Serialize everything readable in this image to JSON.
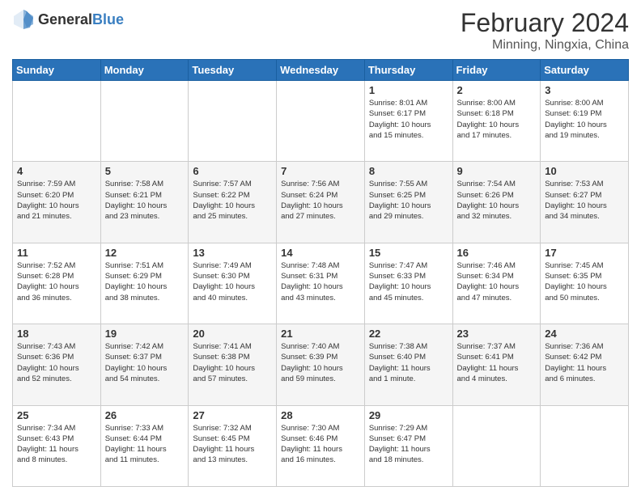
{
  "header": {
    "logo_general": "General",
    "logo_blue": "Blue",
    "title": "February 2024",
    "subtitle": "Minning, Ningxia, China"
  },
  "weekdays": [
    "Sunday",
    "Monday",
    "Tuesday",
    "Wednesday",
    "Thursday",
    "Friday",
    "Saturday"
  ],
  "weeks": [
    [
      {
        "day": "",
        "info": ""
      },
      {
        "day": "",
        "info": ""
      },
      {
        "day": "",
        "info": ""
      },
      {
        "day": "",
        "info": ""
      },
      {
        "day": "1",
        "info": "Sunrise: 8:01 AM\nSunset: 6:17 PM\nDaylight: 10 hours\nand 15 minutes."
      },
      {
        "day": "2",
        "info": "Sunrise: 8:00 AM\nSunset: 6:18 PM\nDaylight: 10 hours\nand 17 minutes."
      },
      {
        "day": "3",
        "info": "Sunrise: 8:00 AM\nSunset: 6:19 PM\nDaylight: 10 hours\nand 19 minutes."
      }
    ],
    [
      {
        "day": "4",
        "info": "Sunrise: 7:59 AM\nSunset: 6:20 PM\nDaylight: 10 hours\nand 21 minutes."
      },
      {
        "day": "5",
        "info": "Sunrise: 7:58 AM\nSunset: 6:21 PM\nDaylight: 10 hours\nand 23 minutes."
      },
      {
        "day": "6",
        "info": "Sunrise: 7:57 AM\nSunset: 6:22 PM\nDaylight: 10 hours\nand 25 minutes."
      },
      {
        "day": "7",
        "info": "Sunrise: 7:56 AM\nSunset: 6:24 PM\nDaylight: 10 hours\nand 27 minutes."
      },
      {
        "day": "8",
        "info": "Sunrise: 7:55 AM\nSunset: 6:25 PM\nDaylight: 10 hours\nand 29 minutes."
      },
      {
        "day": "9",
        "info": "Sunrise: 7:54 AM\nSunset: 6:26 PM\nDaylight: 10 hours\nand 32 minutes."
      },
      {
        "day": "10",
        "info": "Sunrise: 7:53 AM\nSunset: 6:27 PM\nDaylight: 10 hours\nand 34 minutes."
      }
    ],
    [
      {
        "day": "11",
        "info": "Sunrise: 7:52 AM\nSunset: 6:28 PM\nDaylight: 10 hours\nand 36 minutes."
      },
      {
        "day": "12",
        "info": "Sunrise: 7:51 AM\nSunset: 6:29 PM\nDaylight: 10 hours\nand 38 minutes."
      },
      {
        "day": "13",
        "info": "Sunrise: 7:49 AM\nSunset: 6:30 PM\nDaylight: 10 hours\nand 40 minutes."
      },
      {
        "day": "14",
        "info": "Sunrise: 7:48 AM\nSunset: 6:31 PM\nDaylight: 10 hours\nand 43 minutes."
      },
      {
        "day": "15",
        "info": "Sunrise: 7:47 AM\nSunset: 6:33 PM\nDaylight: 10 hours\nand 45 minutes."
      },
      {
        "day": "16",
        "info": "Sunrise: 7:46 AM\nSunset: 6:34 PM\nDaylight: 10 hours\nand 47 minutes."
      },
      {
        "day": "17",
        "info": "Sunrise: 7:45 AM\nSunset: 6:35 PM\nDaylight: 10 hours\nand 50 minutes."
      }
    ],
    [
      {
        "day": "18",
        "info": "Sunrise: 7:43 AM\nSunset: 6:36 PM\nDaylight: 10 hours\nand 52 minutes."
      },
      {
        "day": "19",
        "info": "Sunrise: 7:42 AM\nSunset: 6:37 PM\nDaylight: 10 hours\nand 54 minutes."
      },
      {
        "day": "20",
        "info": "Sunrise: 7:41 AM\nSunset: 6:38 PM\nDaylight: 10 hours\nand 57 minutes."
      },
      {
        "day": "21",
        "info": "Sunrise: 7:40 AM\nSunset: 6:39 PM\nDaylight: 10 hours\nand 59 minutes."
      },
      {
        "day": "22",
        "info": "Sunrise: 7:38 AM\nSunset: 6:40 PM\nDaylight: 11 hours\nand 1 minute."
      },
      {
        "day": "23",
        "info": "Sunrise: 7:37 AM\nSunset: 6:41 PM\nDaylight: 11 hours\nand 4 minutes."
      },
      {
        "day": "24",
        "info": "Sunrise: 7:36 AM\nSunset: 6:42 PM\nDaylight: 11 hours\nand 6 minutes."
      }
    ],
    [
      {
        "day": "25",
        "info": "Sunrise: 7:34 AM\nSunset: 6:43 PM\nDaylight: 11 hours\nand 8 minutes."
      },
      {
        "day": "26",
        "info": "Sunrise: 7:33 AM\nSunset: 6:44 PM\nDaylight: 11 hours\nand 11 minutes."
      },
      {
        "day": "27",
        "info": "Sunrise: 7:32 AM\nSunset: 6:45 PM\nDaylight: 11 hours\nand 13 minutes."
      },
      {
        "day": "28",
        "info": "Sunrise: 7:30 AM\nSunset: 6:46 PM\nDaylight: 11 hours\nand 16 minutes."
      },
      {
        "day": "29",
        "info": "Sunrise: 7:29 AM\nSunset: 6:47 PM\nDaylight: 11 hours\nand 18 minutes."
      },
      {
        "day": "",
        "info": ""
      },
      {
        "day": "",
        "info": ""
      }
    ]
  ]
}
